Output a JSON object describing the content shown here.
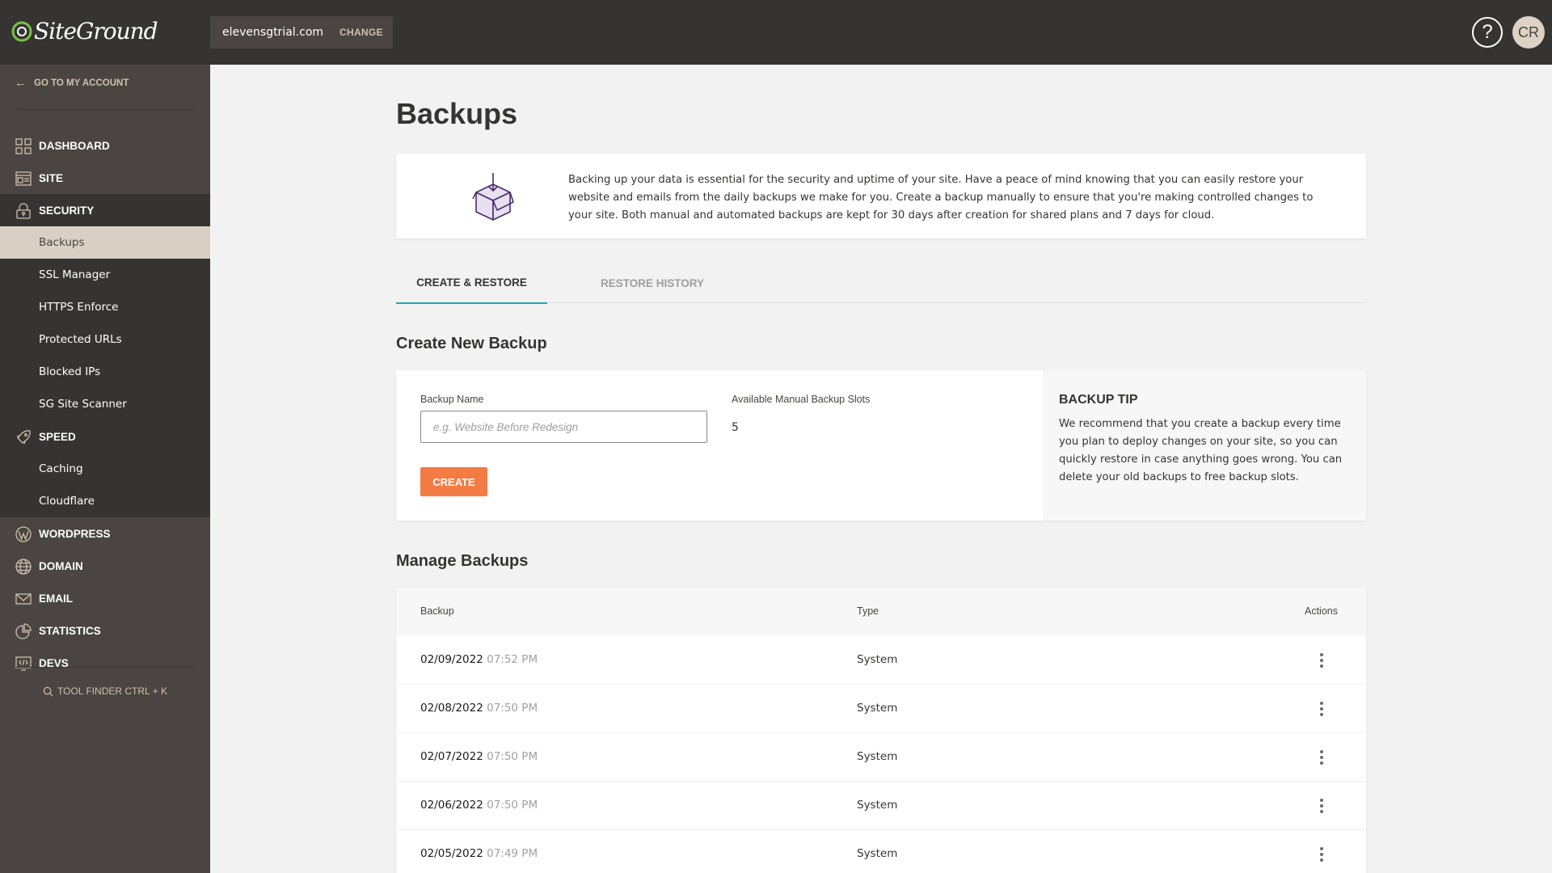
{
  "header": {
    "logo_text": "SiteGround",
    "domain": "elevensgtrial.com",
    "change_label": "CHANGE",
    "help_icon": "?",
    "avatar_initials": "CR"
  },
  "sidebar": {
    "back_label": "GO TO MY ACCOUNT",
    "items": [
      {
        "label": "DASHBOARD",
        "icon": "dashboard-grid-icon"
      },
      {
        "label": "SITE",
        "icon": "site-window-icon"
      },
      {
        "label": "SECURITY",
        "icon": "lock-icon"
      },
      {
        "label": "Backups",
        "active": true
      },
      {
        "label": "SSL Manager"
      },
      {
        "label": "HTTPS Enforce"
      },
      {
        "label": "Protected URLs"
      },
      {
        "label": "Blocked IPs"
      },
      {
        "label": "SG Site Scanner"
      },
      {
        "label": "SPEED",
        "icon": "rocket-icon"
      },
      {
        "label": "Caching"
      },
      {
        "label": "Cloudflare"
      },
      {
        "label": "WORDPRESS",
        "icon": "wordpress-icon"
      },
      {
        "label": "DOMAIN",
        "icon": "globe-icon"
      },
      {
        "label": "EMAIL",
        "icon": "envelope-icon"
      },
      {
        "label": "STATISTICS",
        "icon": "pie-chart-icon"
      },
      {
        "label": "DEVS",
        "icon": "code-monitor-icon"
      }
    ],
    "tool_finder": "TOOL FINDER CTRL + K"
  },
  "main": {
    "title": "Backups",
    "info_text": "Backing up your data is essential for the security and uptime of your site. Have a peace of mind knowing that you can easily restore your website and emails from the daily backups we make for you. Create a backup manually to ensure that you're making controlled changes to your site. Both manual and automated backups are kept for 30 days after creation for shared plans and 7 days for cloud.",
    "tabs": [
      {
        "label": "CREATE & RESTORE",
        "active": true
      },
      {
        "label": "RESTORE HISTORY",
        "active": false
      }
    ],
    "create": {
      "heading": "Create New Backup",
      "name_label": "Backup Name",
      "name_placeholder": "e.g. Website Before Redesign",
      "name_value": "",
      "slots_label": "Available Manual Backup Slots",
      "slots_value": "5",
      "create_button": "CREATE",
      "tip_title": "BACKUP TIP",
      "tip_text": "We recommend that you create a backup every time you plan to deploy changes on your site, so you can quickly restore in case anything goes wrong. You can delete your old backups to free backup slots."
    },
    "manage": {
      "heading": "Manage Backups",
      "columns": [
        "Backup",
        "Type",
        "Actions"
      ],
      "rows": [
        {
          "date": "02/09/2022",
          "time": "07:52 PM",
          "type": "System"
        },
        {
          "date": "02/08/2022",
          "time": "07:50 PM",
          "type": "System"
        },
        {
          "date": "02/07/2022",
          "time": "07:50 PM",
          "type": "System"
        },
        {
          "date": "02/06/2022",
          "time": "07:50 PM",
          "type": "System"
        },
        {
          "date": "02/05/2022",
          "time": "07:49 PM",
          "type": "System"
        }
      ]
    }
  },
  "colors": {
    "header_bg": "#363432",
    "sidebar_bg": "#4a4542",
    "active_item_bg": "#d8d0c4",
    "accent_tab": "#24a5b4",
    "create_button": "#f37c45",
    "brand_green": "#7ac143"
  }
}
